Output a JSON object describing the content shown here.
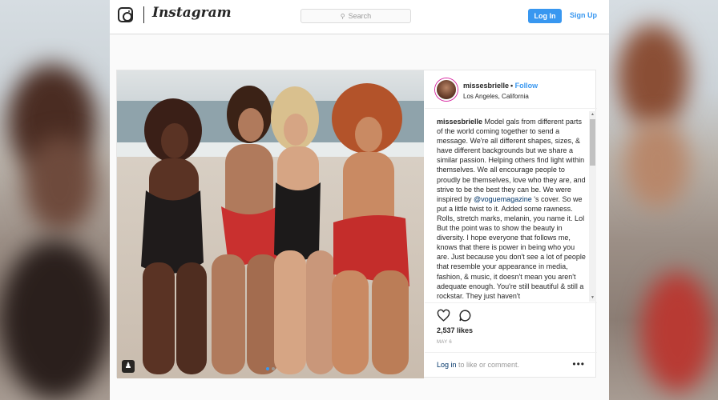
{
  "header": {
    "wordmark": "Instagram",
    "search_placeholder": "Search",
    "login_label": "Log In",
    "signup_label": "Sign Up"
  },
  "post": {
    "username": "missesbrielle",
    "follow_separator": "•",
    "follow_label": "Follow",
    "location": "Los Angeles, California",
    "caption_username": "missesbrielle",
    "caption_part1": " Model gals from different parts of the world coming together to send a message. We're all different shapes, sizes, & have different backgrounds but we share a similar passion. Helping others find light within themselves. We all encourage people to proudly be themselves, love who they are, and strive to be the best they can be. We were inspired by ",
    "caption_mention": "@voguemagazine",
    "caption_part2": " 's cover. So we put a little twist to it. Added some rawness. Rolls, stretch marks, melanin, you name it. Lol But the point was to show the beauty in diversity. I hope everyone that follows me, knows that there is power in being who you are. Just because you don't see a lot of people that resemble your appearance in media, fashion, & music, it doesn't mean you aren't adequate enough. You're still beautiful & still a rockstar. They just haven't",
    "likes": "2,537 likes",
    "date": "MAY 6",
    "comment_login": "Log in",
    "comment_rest": " to like or comment.",
    "more": "•••"
  },
  "icons": {
    "camera": "instagram-camera-icon",
    "search": "search-icon",
    "heart": "heart-icon",
    "comment": "comment-icon",
    "tag": "user-tag-icon",
    "more": "more-options-icon"
  },
  "colors": {
    "accent": "#3897f0",
    "text": "#262626",
    "muted": "#999999",
    "link_dark": "#003569"
  }
}
